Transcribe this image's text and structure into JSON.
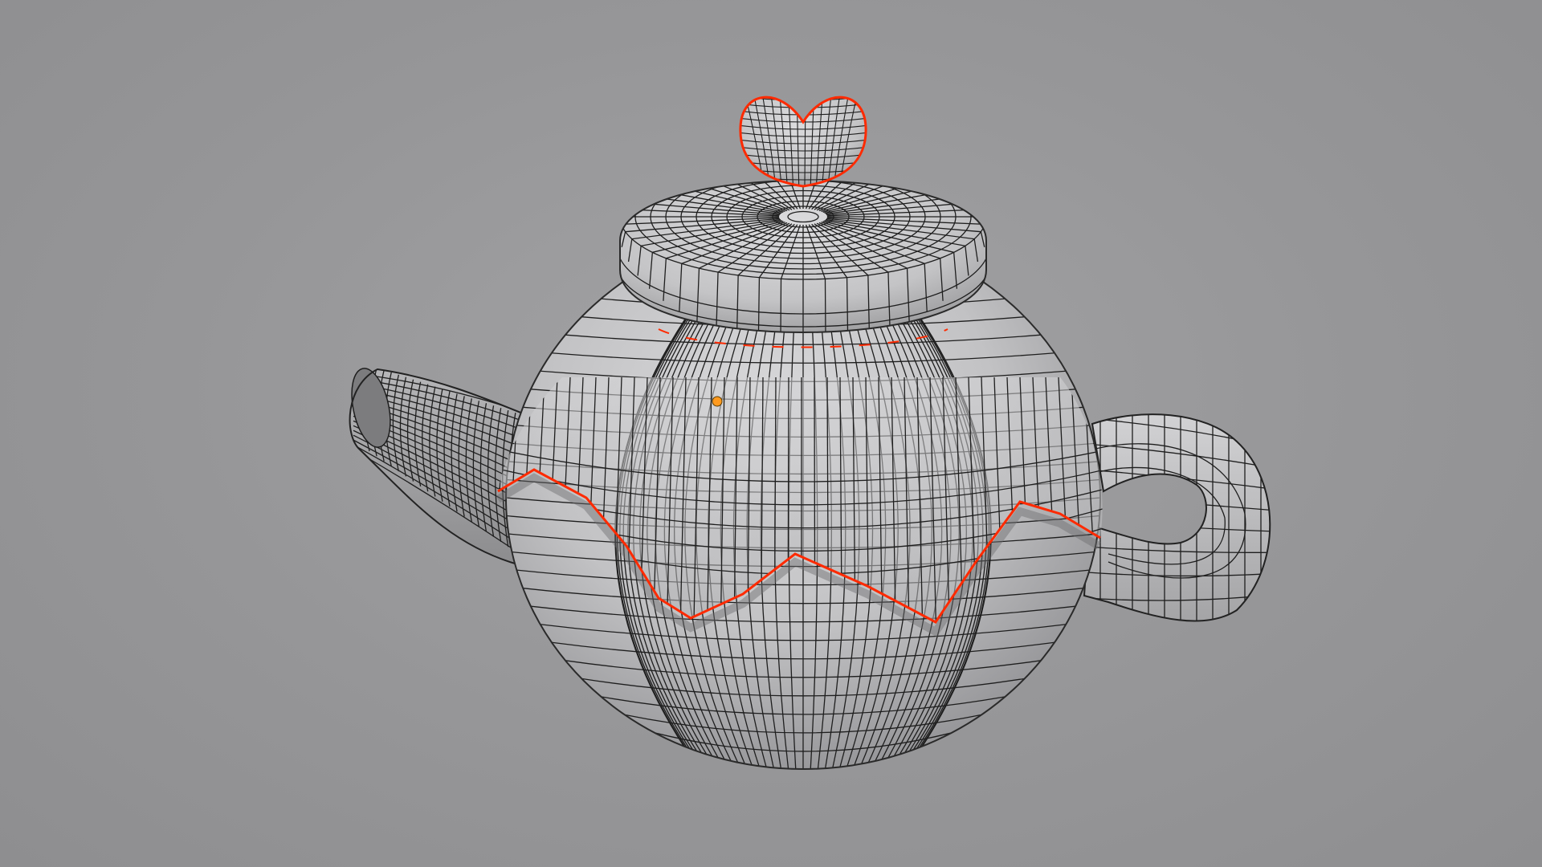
{
  "viewport": {
    "background_color": "#969698",
    "mesh_color": "#c4c4c6",
    "wire_color": "#1e1e1e",
    "selection_color": "#ff2a00",
    "origin_color": "#ff9a1f"
  },
  "scene": {
    "object": "teapot",
    "display_mode": "solid-with-wireframe",
    "parts": [
      "body",
      "lid",
      "knob",
      "spout",
      "handle",
      "band"
    ]
  }
}
